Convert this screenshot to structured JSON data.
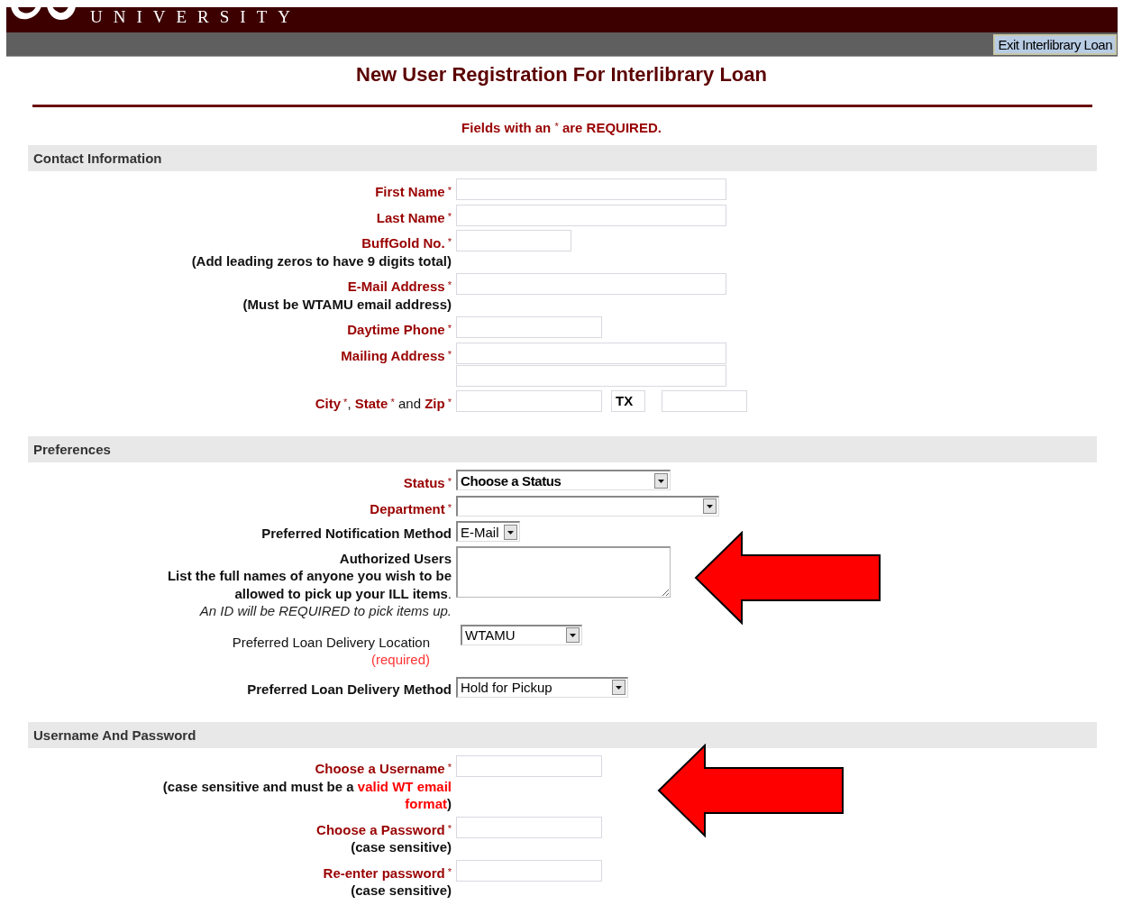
{
  "header": {
    "wordmark": "UNIVERSITY",
    "exit_button": "Exit Interlibrary Loan"
  },
  "title": "New User Registration For Interlibrary Loan",
  "required_note": {
    "parts": [
      {
        "text": "Fields with an ",
        "kind": "field"
      },
      {
        "text": "*",
        "kind": "star"
      },
      {
        "text": " are REQUIRED.",
        "kind": "field"
      }
    ]
  },
  "sections": [
    {
      "title": "Contact Information",
      "rows": [
        {
          "kind": "inline",
          "lines": [
            {
              "parts": [
                {
                  "text": "First Name",
                  "kind": "field"
                },
                {
                  "text": " *",
                  "kind": "star"
                }
              ]
            }
          ],
          "fields": [
            {
              "kind": "textbox"
            }
          ]
        },
        {
          "kind": "inline",
          "lines": [
            {
              "parts": [
                {
                  "text": "Last Name",
                  "kind": "field"
                },
                {
                  "text": " *",
                  "kind": "star"
                }
              ]
            }
          ],
          "fields": [
            {
              "kind": "textbox"
            }
          ]
        },
        {
          "kind": "inline",
          "lines": [
            {
              "parts": [
                {
                  "text": "BuffGold No.",
                  "kind": "field"
                },
                {
                  "text": " *",
                  "kind": "star"
                }
              ]
            },
            {
              "parts": [
                {
                  "text": "(Add leading zeros to have 9 digits total)",
                  "kind": "bold"
                }
              ]
            }
          ],
          "fields": [
            {
              "kind": "idbox"
            }
          ]
        },
        {
          "kind": "inline",
          "lines": [
            {
              "parts": [
                {
                  "text": "E-Mail Address",
                  "kind": "field"
                },
                {
                  "text": " *",
                  "kind": "star"
                }
              ]
            },
            {
              "parts": [
                {
                  "text": "(Must be WTAMU email address)",
                  "kind": "bold"
                }
              ]
            }
          ],
          "fields": [
            {
              "kind": "textbox"
            }
          ]
        },
        {
          "kind": "inline",
          "lines": [
            {
              "parts": [
                {
                  "text": "Daytime Phone",
                  "kind": "field"
                },
                {
                  "text": " *",
                  "kind": "star"
                }
              ]
            }
          ],
          "fields": [
            {
              "kind": "shortbox"
            }
          ]
        },
        {
          "kind": "stacked",
          "lines": [
            {
              "parts": [
                {
                  "text": "Mailing Address",
                  "kind": "field"
                },
                {
                  "text": " *",
                  "kind": "star"
                }
              ]
            }
          ],
          "fields": [
            {
              "kind": "textbox"
            },
            {
              "kind": "textbox"
            }
          ]
        },
        {
          "kind": "inline",
          "lines": [
            {
              "parts": [
                {
                  "text": "City",
                  "kind": "field"
                },
                {
                  "text": " *",
                  "kind": "star"
                },
                {
                  "text": ", ",
                  "kind": "plain"
                },
                {
                  "text": "State",
                  "kind": "field"
                },
                {
                  "text": " *",
                  "kind": "star"
                },
                {
                  "text": " and ",
                  "kind": "plain"
                },
                {
                  "text": "Zip",
                  "kind": "field"
                },
                {
                  "text": " *",
                  "kind": "star"
                }
              ]
            }
          ],
          "fields": [
            {
              "kind": "shortbox"
            },
            {
              "kind": "statebox",
              "value": "TX"
            },
            {
              "kind": "zipbox"
            }
          ]
        }
      ]
    },
    {
      "title": "Preferences",
      "rows": [
        {
          "kind": "inline",
          "lines": [
            {
              "parts": [
                {
                  "text": "Status",
                  "kind": "field"
                },
                {
                  "text": " *",
                  "kind": "star"
                }
              ]
            }
          ],
          "fields": [
            {
              "kind": "statusmenu",
              "value": "Choose a Status"
            }
          ]
        },
        {
          "kind": "inline",
          "lines": [
            {
              "parts": [
                {
                  "text": "Department",
                  "kind": "field"
                },
                {
                  "text": " *",
                  "kind": "star"
                }
              ]
            }
          ],
          "fields": [
            {
              "kind": "widemenu"
            }
          ]
        },
        {
          "kind": "inline",
          "lines": [
            {
              "parts": [
                {
                  "text": "Preferred Notification Method",
                  "kind": "bold"
                }
              ]
            }
          ],
          "fields": [
            {
              "kind": "tinymenu",
              "value": "E-Mail"
            }
          ]
        },
        {
          "kind": "inline",
          "lines": [
            {
              "parts": [
                {
                  "text": "Authorized Users",
                  "kind": "bold"
                }
              ]
            },
            {
              "parts": [
                {
                  "text": "List the full names of anyone you wish to be",
                  "kind": "bold"
                }
              ]
            },
            {
              "parts": [
                {
                  "text": "allowed to pick up your ILL items",
                  "kind": "bold"
                },
                {
                  "text": ".",
                  "kind": "plain"
                }
              ]
            },
            {
              "parts": [
                {
                  "text": "An ID will be REQUIRED to pick items up.",
                  "kind": "italic"
                }
              ]
            }
          ],
          "fields": [
            {
              "kind": "textarea"
            }
          ]
        },
        {
          "kind": "loose",
          "lines": [
            {
              "parts": [
                {
                  "text": "Preferred Loan Delivery Location",
                  "kind": "plain"
                }
              ]
            },
            {
              "parts": [
                {
                  "text": "(required)",
                  "kind": "hint"
                }
              ]
            }
          ],
          "fields": [
            {
              "kind": "smallmenu",
              "value": "WTAMU"
            }
          ]
        },
        {
          "kind": "inline",
          "lines": [
            {
              "parts": [
                {
                  "text": "Preferred Loan Delivery Method",
                  "kind": "bold"
                }
              ]
            }
          ],
          "fields": [
            {
              "kind": "midmenu",
              "value": "Hold for Pickup"
            }
          ]
        }
      ]
    },
    {
      "title": "Username And Password",
      "rows": [
        {
          "kind": "inline",
          "lines": [
            {
              "parts": [
                {
                  "text": "Choose a Username",
                  "kind": "field"
                },
                {
                  "text": " *",
                  "kind": "star"
                }
              ]
            },
            {
              "parts": [
                {
                  "text": "(case sensitive and must be a ",
                  "kind": "bold"
                },
                {
                  "text": "valid WT email",
                  "kind": "alert"
                }
              ]
            },
            {
              "parts": [
                {
                  "text": "format",
                  "kind": "alert"
                },
                {
                  "text": ")",
                  "kind": "bold"
                }
              ]
            }
          ],
          "fields": [
            {
              "kind": "shortbox"
            }
          ]
        },
        {
          "kind": "inline",
          "lines": [
            {
              "parts": [
                {
                  "text": "Choose a Password",
                  "kind": "field"
                },
                {
                  "text": " *",
                  "kind": "star"
                }
              ]
            },
            {
              "parts": [
                {
                  "text": "(case sensitive)",
                  "kind": "bold"
                }
              ]
            }
          ],
          "fields": [
            {
              "kind": "shortbox"
            }
          ]
        },
        {
          "kind": "inline",
          "lines": [
            {
              "parts": [
                {
                  "text": "Re-enter password",
                  "kind": "field"
                },
                {
                  "text": " *",
                  "kind": "star"
                }
              ]
            },
            {
              "parts": [
                {
                  "text": "(case sensitive)",
                  "kind": "bold"
                }
              ]
            }
          ],
          "fields": [
            {
              "kind": "shortbox"
            }
          ]
        }
      ]
    }
  ]
}
